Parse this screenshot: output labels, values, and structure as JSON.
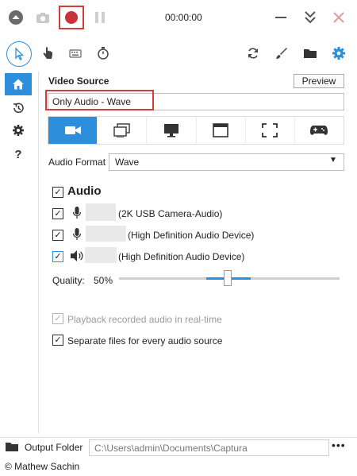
{
  "titlebar": {
    "timer": "00:00:00",
    "icons": [
      "menu-up-icon",
      "camera-icon",
      "record-icon",
      "pause-icon",
      "minimize-icon",
      "collapse-icon",
      "close-icon"
    ]
  },
  "toolbar": {
    "icons": [
      "cursor-icon",
      "click-hand-icon",
      "keyboard-icon",
      "timer-icon",
      "refresh-icon",
      "brush-icon",
      "folder-icon",
      "settings-icon"
    ]
  },
  "sidebar": {
    "help_label": "?"
  },
  "video_source": {
    "title": "Video Source",
    "preview_label": "Preview",
    "current": "Only Audio  -  Wave",
    "tabs": [
      "webcam",
      "window",
      "screen",
      "fullscreen-window",
      "region",
      "game"
    ]
  },
  "audio_format": {
    "label": "Audio Format",
    "value": "Wave"
  },
  "audio": {
    "heading": "Audio",
    "devices": [
      {
        "name": "(2K USB Camera-Audio)",
        "checked": true,
        "icon": "microphone-icon"
      },
      {
        "name": "(High Definition Audio Device)",
        "checked": true,
        "icon": "microphone-icon"
      },
      {
        "name": "(High Definition Audio Device)",
        "checked": true,
        "icon": "speaker-icon"
      }
    ],
    "quality_label": "Quality:",
    "quality_value": "50%",
    "quality_fraction": 0.5,
    "playback_label": "Playback recorded audio in real-time",
    "separate_label": "Separate files for every audio source"
  },
  "output": {
    "label": "Output Folder",
    "path": "C:\\Users\\admin\\Documents\\Captura",
    "more": "•••"
  },
  "footer": {
    "text": "© Mathew Sachin"
  },
  "colors": {
    "accent": "#2d8fdb",
    "record": "#c8323a",
    "highlight": "#d63b3b"
  }
}
